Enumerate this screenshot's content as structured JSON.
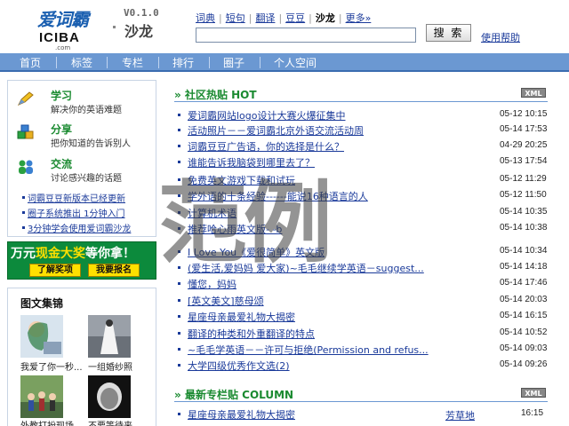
{
  "header": {
    "logo_top": "爱词霸",
    "logo_bottom": "ICIBA",
    "logo_com": ".com",
    "version": "V0.1.0",
    "site_name": "沙龙",
    "top_nav": [
      {
        "label": "词典",
        "active": false
      },
      {
        "label": "短句",
        "active": false
      },
      {
        "label": "翻译",
        "active": false
      },
      {
        "label": "豆豆",
        "active": false
      },
      {
        "label": "沙龙",
        "active": true
      },
      {
        "label": "更多»",
        "active": false
      }
    ],
    "search_value": "",
    "search_button": "搜 索",
    "help_link": "使用帮助"
  },
  "main_nav": [
    "首页",
    "标签",
    "专栏",
    "排行",
    "圈子",
    "个人空间"
  ],
  "left": {
    "features": [
      {
        "title": "学习",
        "subtitle": "解决你的英语难题",
        "icon": "pencil-icon"
      },
      {
        "title": "分享",
        "subtitle": "把你知道的告诉别人",
        "icon": "cubes-icon"
      },
      {
        "title": "交流",
        "subtitle": "讨论感兴趣的话题",
        "icon": "people-icon"
      }
    ],
    "links": [
      "词霸豆豆新版本已经更新",
      "圈子系统推出 1分钟入门",
      "3分钟学会使用爱词霸沙龙"
    ],
    "banner": {
      "title_pre": "万元",
      "title_highlight": "现金大奖",
      "title_post": "等你拿！",
      "buttons": [
        "了解奖项",
        "我要报名"
      ]
    },
    "photo_section": {
      "title": "图文集锦",
      "items": [
        "我爱了你一秒...",
        "一组婚纱照",
        "外教打扮现场",
        "不要等待来"
      ]
    }
  },
  "hot": {
    "title": "社区热贴 HOT",
    "xml_label": "XML",
    "posts": [
      {
        "title": "爱词霸网站logo设计大赛火爆征集中",
        "date": "05-12 10:15"
      },
      {
        "title": "活动照片－－爱词霸北京外语交流活动周",
        "date": "05-14 17:53"
      },
      {
        "title": "词霸豆豆广告语，你的选择是什么？",
        "date": "04-29 20:25"
      },
      {
        "title": "谁能告诉我脑袋到哪里去了？",
        "date": "05-13 17:54"
      },
      {
        "title": "免费英文游戏下载和试玩",
        "date": "05-12 11:29"
      },
      {
        "title": "学外语的十条经验------能说16种语言的人",
        "date": "05-12 11:50"
      },
      {
        "title": "计算机术语",
        "date": "05-14 10:35"
      },
      {
        "title": "推荐哈心雨英文版- -b",
        "date": "05-14 10:38"
      },
      {
        "title": "I Love You《爱很简单》英文版",
        "date": "05-14 10:34"
      },
      {
        "title": "(爱生活,爱妈妈 爱大家)~毛毛继续学英语－suggest...",
        "date": "05-14 14:18"
      },
      {
        "title": "懂您，妈妈",
        "date": "05-14 17:46"
      },
      {
        "title": "[英文美文]慈母颂",
        "date": "05-14 20:03"
      },
      {
        "title": "星座母亲最爱礼物大揭密",
        "date": "05-14 16:15"
      },
      {
        "title": "翻译的种类和外重翻译的特点",
        "date": "05-14 10:52"
      },
      {
        "title": "~毛毛学英语－－许可与拒绝(Permission and refus...",
        "date": "05-14 09:03"
      },
      {
        "title": "大学四级优秀作文选(2)",
        "date": "05-14 09:26"
      }
    ]
  },
  "column": {
    "title": "最新专栏贴 COLUMN",
    "xml_label": "XML",
    "posts": [
      {
        "title": "星座母亲最爱礼物大揭密",
        "author": "芳草地",
        "date": "16:15"
      }
    ]
  },
  "watermark": "范例",
  "colors": {
    "nav_blue": "#6b98d2",
    "link_blue": "#1a3a9a",
    "green": "#1a8a30",
    "banner_green": "#0c8a3c",
    "banner_yellow": "#ffe000"
  }
}
